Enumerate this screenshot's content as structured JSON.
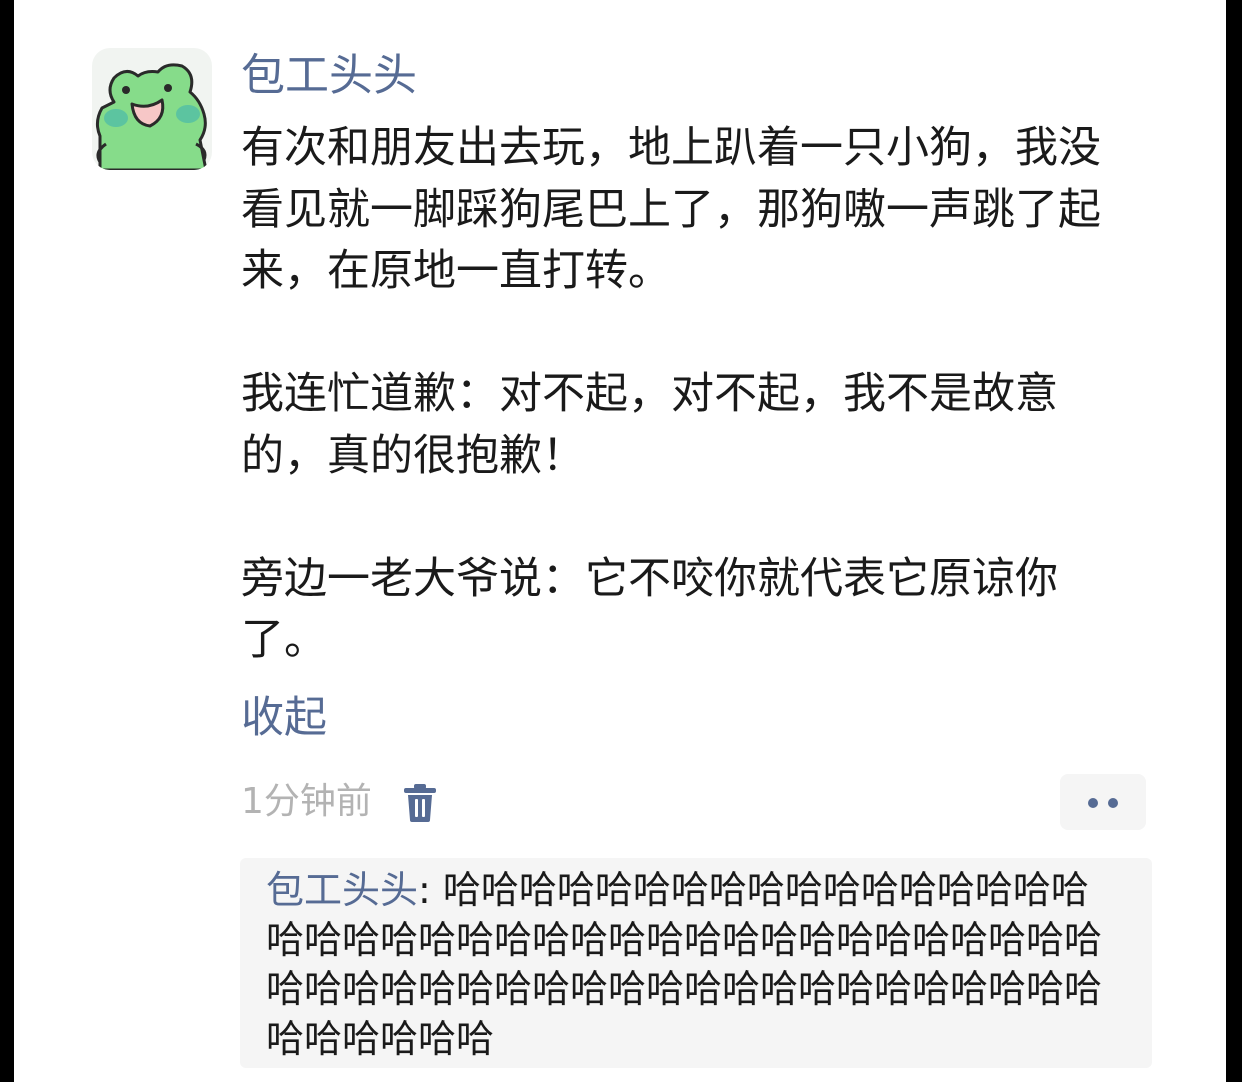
{
  "post": {
    "author": "包工头头",
    "paragraphs": [
      "有次和朋友出去玩，地上趴着一只小狗，我没看见就一脚踩狗尾巴上了，那狗嗷一声跳了起来，在原地一直打转。",
      "我连忙道歉：对不起，对不起，我不是故意的，真的很抱歉！",
      "旁边一老大爷说：它不咬你就代表它原谅你了。"
    ],
    "collapse_label": "收起",
    "timestamp": "1分钟前"
  },
  "reply": {
    "author": "包工头头",
    "separator": ": ",
    "text": "哈哈哈哈哈哈哈哈哈哈哈哈哈哈哈哈哈哈哈哈哈哈哈哈哈哈哈哈哈哈哈哈哈哈哈哈哈哈哈哈哈哈哈哈哈哈哈哈哈哈哈哈哈哈哈哈哈哈哈哈哈哈哈哈哈哈哈"
  },
  "icons": {
    "avatar": "green-frog-avatar",
    "delete": "trash-icon",
    "more": "more-dots-icon"
  },
  "colors": {
    "link": "#566b94",
    "text": "#1a1a1a",
    "muted": "#b3b3b3",
    "avatar_green": "#86dc8a"
  }
}
